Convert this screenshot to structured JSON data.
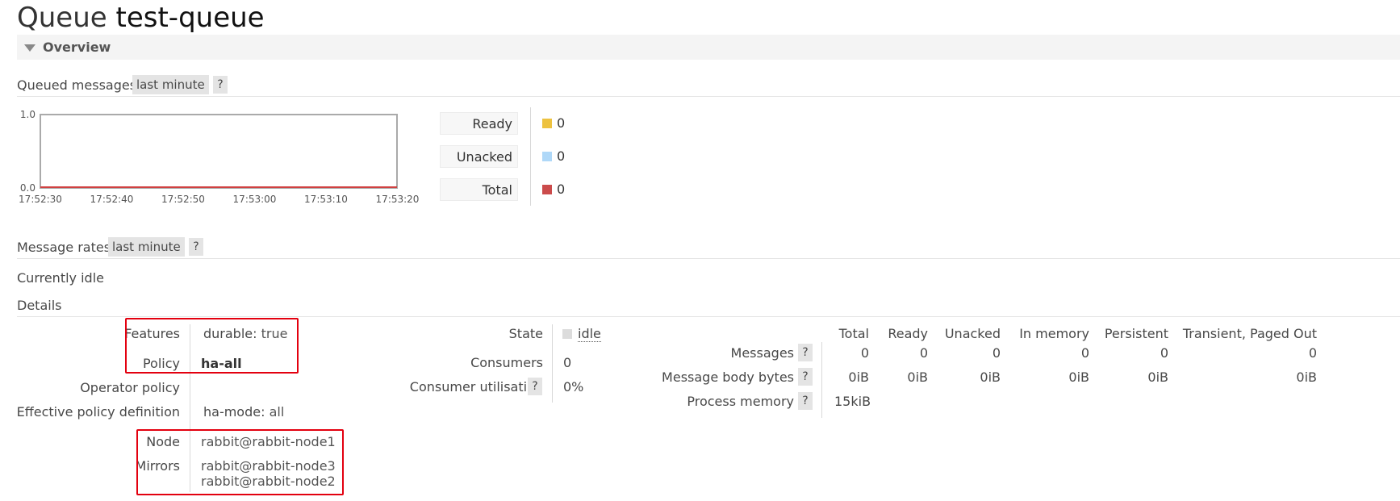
{
  "page": {
    "title_prefix": "Queue",
    "queue_name": "test-queue",
    "overview_label": "Overview"
  },
  "queued_messages": {
    "title": "Queued messages",
    "range": "last minute",
    "help": "?",
    "chart_data": {
      "type": "line",
      "x": [
        "17:52:30",
        "17:52:40",
        "17:52:50",
        "17:53:00",
        "17:53:10",
        "17:53:20"
      ],
      "y_tick_labels": [
        "1.0",
        "0.0"
      ],
      "ylim": [
        0,
        1
      ],
      "series": [
        {
          "name": "Total",
          "color": "#d04040",
          "values": [
            0,
            0,
            0,
            0,
            0,
            0
          ]
        }
      ]
    },
    "legend": [
      {
        "label": "Ready",
        "value": "0",
        "color": "#edc240"
      },
      {
        "label": "Unacked",
        "value": "0",
        "color": "#afd8f8"
      },
      {
        "label": "Total",
        "value": "0",
        "color": "#cb4b4b"
      }
    ]
  },
  "message_rates": {
    "title": "Message rates",
    "range": "last minute",
    "help": "?",
    "status": "Currently idle"
  },
  "details": {
    "title": "Details",
    "features_label": "Features",
    "features_key": "durable:",
    "features_value": "true",
    "policy_label": "Policy",
    "policy_value": "ha-all",
    "operator_policy_label": "Operator policy",
    "effective_policy_label": "Effective policy definition",
    "effective_policy_key": "ha-mode:",
    "effective_policy_value": "all",
    "node_label": "Node",
    "node_value": "rabbit@rabbit-node1",
    "mirrors_label": "Mirrors",
    "mirrors": [
      "rabbit@rabbit-node3",
      "rabbit@rabbit-node2"
    ],
    "state_label": "State",
    "state_value": "idle",
    "consumers_label": "Consumers",
    "consumers_value": "0",
    "consumer_util_label": "Consumer utilisation",
    "consumer_util_value": "0%",
    "help": "?"
  },
  "stats_table": {
    "columns": [
      "Total",
      "Ready",
      "Unacked",
      "In memory",
      "Persistent",
      "Transient, Paged Out"
    ],
    "rows": [
      {
        "label": "Messages",
        "values": [
          "0",
          "0",
          "0",
          "0",
          "0",
          "0"
        ]
      },
      {
        "label": "Message body bytes",
        "values": [
          "0iB",
          "0iB",
          "0iB",
          "0iB",
          "0iB",
          "0iB"
        ]
      },
      {
        "label": "Process memory",
        "values": [
          "15kiB"
        ]
      }
    ]
  }
}
